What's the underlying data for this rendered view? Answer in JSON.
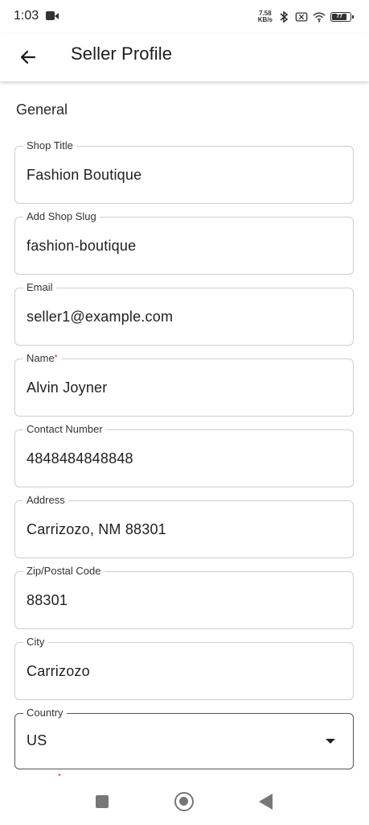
{
  "status_bar": {
    "time": "1:03",
    "net_speed_value": "7.58",
    "net_speed_unit": "KB/s",
    "battery_level": "77"
  },
  "app_bar": {
    "title": "Seller Profile"
  },
  "section": {
    "title": "General"
  },
  "fields": [
    {
      "label": "Shop Title",
      "value": "Fashion Boutique",
      "required": false
    },
    {
      "label": "Add Shop Slug",
      "value": "fashion-boutique",
      "required": false
    },
    {
      "label": "Email",
      "value": "seller1@example.com",
      "required": false
    },
    {
      "label": "Name",
      "value": "Alvin Joyner",
      "required": true,
      "required_mark": "*"
    },
    {
      "label": "Contact Number",
      "value": "4848484848848",
      "required": false
    },
    {
      "label": "Address",
      "value": "Carrizozo, NM 88301",
      "required": false
    },
    {
      "label": "Zip/Postal Code",
      "value": "88301",
      "required": false
    },
    {
      "label": "City",
      "value": "Carrizozo",
      "required": false
    },
    {
      "label": "Country",
      "value": "US",
      "required": false,
      "type": "dropdown"
    }
  ],
  "next_field_required_mark": "*",
  "icons": {
    "back": "arrow-left-icon",
    "dropdown": "caret-down-icon",
    "nav_recents": "square-icon",
    "nav_home": "circle-icon",
    "nav_back": "triangle-back-icon"
  }
}
